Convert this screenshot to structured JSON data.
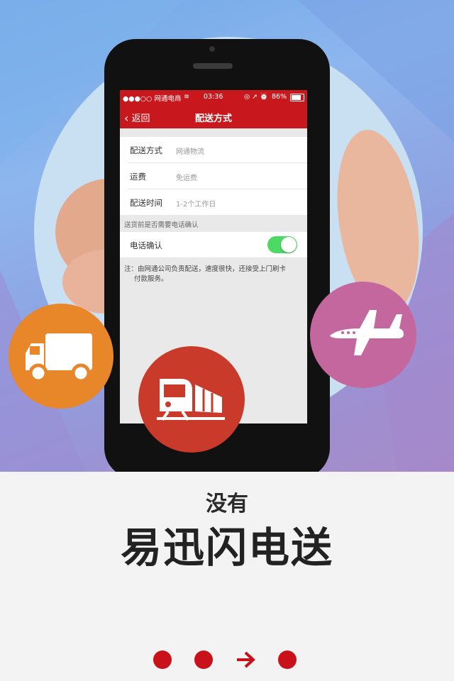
{
  "status_bar": {
    "carrier": "●●●○○ 网通电商",
    "time": "03:36",
    "battery": "86%"
  },
  "nav": {
    "back_label": "返回",
    "title": "配送方式"
  },
  "details": [
    {
      "label": "配送方式",
      "value": "网通物流"
    },
    {
      "label": "运费",
      "value": "免运费"
    },
    {
      "label": "配送时间",
      "value": "1-2个工作日"
    }
  ],
  "phone_confirm": {
    "section_header": "送货前是否需要电话确认",
    "label": "电话确认",
    "enabled": true
  },
  "note": {
    "line1": "注：由网通公司负责配送，速度很快，还接受上门刷卡",
    "line2": "付款服务。"
  },
  "icons": {
    "truck": "truck-icon",
    "train": "train-icon",
    "plane": "airplane-icon"
  },
  "colors": {
    "brand_red": "#c8181e",
    "truck_badge": "#e8862a",
    "train_badge": "#c93a2a",
    "plane_badge": "#c4679e",
    "toggle_on": "#4cd964"
  },
  "headline": {
    "small": "没有",
    "big": "易迅闪电送"
  },
  "pagination": {
    "total": 4,
    "current": 3
  }
}
